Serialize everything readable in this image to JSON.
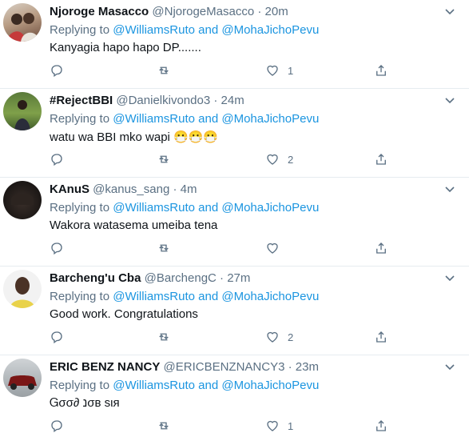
{
  "reply_prefix": "Replying to",
  "reply_and": "and",
  "tweets": [
    {
      "name": "Njoroge Masacco",
      "handle": "@NjorogeMasacco",
      "dot": "·",
      "time": "20m",
      "reply_to_1": "@WilliamsRuto",
      "reply_to_2": "@MohaJichoPevu",
      "text": "Kanyagia hapo hapo DP.......",
      "likes": "1"
    },
    {
      "name": "#RejectBBI",
      "handle": "@Danielkivondo3",
      "dot": "·",
      "time": "24m",
      "reply_to_1": "@WilliamsRuto",
      "reply_to_2": "@MohaJichoPevu",
      "text": "watu wa BBI mko wapi 😷😷😷",
      "likes": "2"
    },
    {
      "name": "KAnuS",
      "handle": "@kanus_sang",
      "dot": "·",
      "time": "4m",
      "reply_to_1": "@WilliamsRuto",
      "reply_to_2": "@MohaJichoPevu",
      "text": "Wakora watasema umeiba tena",
      "likes": ""
    },
    {
      "name": "Barcheng'u Cba",
      "handle": "@BarchengC",
      "dot": "·",
      "time": "27m",
      "reply_to_1": "@WilliamsRuto",
      "reply_to_2": "@MohaJichoPevu",
      "text": "Good work. Congratulations",
      "likes": "2"
    },
    {
      "name": "ERIC BENZ NANCY",
      "handle": "@ERICBENZNANCY3",
      "dot": "·",
      "time": "23m",
      "reply_to_1": "@WilliamsRuto",
      "reply_to_2": "@MohaJichoPevu",
      "text": "Ꮐσσ∂ נσв ѕιя",
      "likes": "1"
    }
  ],
  "colors": {
    "link": "#1b95e0",
    "secondary": "#5b7083",
    "divider": "#e6ecf0"
  }
}
